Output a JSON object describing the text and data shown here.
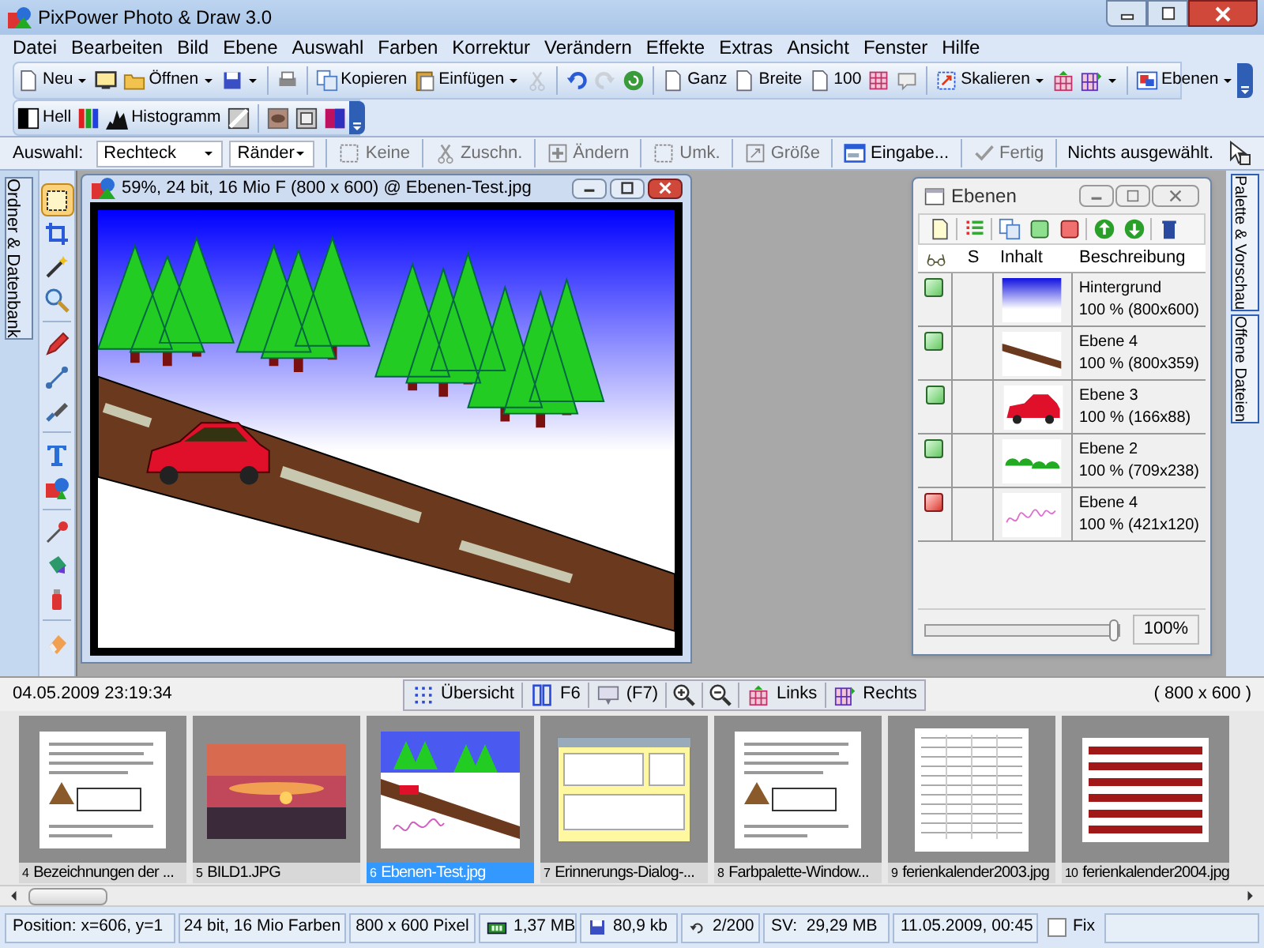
{
  "window": {
    "title": "PixPower Photo & Draw 3.0"
  },
  "menu": [
    "Datei",
    "Bearbeiten",
    "Bild",
    "Ebene",
    "Auswahl",
    "Farben",
    "Korrektur",
    "Verändern",
    "Effekte",
    "Extras",
    "Ansicht",
    "Fenster",
    "Hilfe"
  ],
  "toolbar_rows": [
    [
      {
        "kind": "button",
        "label": "Neu",
        "dropdown": true,
        "disabled": false
      },
      {
        "kind": "icon",
        "dropdown": false,
        "disabled": false
      },
      {
        "kind": "button",
        "label": "Öffnen",
        "dropdown": true,
        "disabled": false
      },
      {
        "kind": "icon",
        "dropdown": true,
        "disabled": false
      },
      {
        "kind": "separator"
      },
      {
        "kind": "icon",
        "dropdown": false,
        "disabled": false
      },
      {
        "kind": "separator"
      },
      {
        "kind": "button",
        "label": "Kopieren",
        "dropdown": false,
        "disabled": false
      },
      {
        "kind": "button",
        "label": "Einfügen",
        "dropdown": true,
        "disabled": false
      },
      {
        "kind": "icon",
        "dropdown": false,
        "disabled": true
      },
      {
        "kind": "separator"
      },
      {
        "kind": "icon",
        "dropdown": false,
        "disabled": false
      },
      {
        "kind": "icon",
        "dropdown": false,
        "disabled": true
      },
      {
        "kind": "icon",
        "dropdown": false,
        "disabled": false
      },
      {
        "kind": "separator"
      },
      {
        "kind": "button",
        "label": "Ganz",
        "dropdown": false,
        "disabled": false
      },
      {
        "kind": "button",
        "label": "Breite",
        "dropdown": false,
        "disabled": false
      },
      {
        "kind": "button",
        "label": "100",
        "dropdown": false,
        "disabled": false
      },
      {
        "kind": "icon",
        "dropdown": false,
        "disabled": false
      },
      {
        "kind": "icon",
        "dropdown": false,
        "disabled": false
      },
      {
        "kind": "separator"
      },
      {
        "kind": "button",
        "label": "Skalieren",
        "dropdown": true,
        "disabled": false
      },
      {
        "kind": "icon",
        "dropdown": false,
        "disabled": false
      },
      {
        "kind": "icon",
        "dropdown": true,
        "disabled": false
      },
      {
        "kind": "separator"
      },
      {
        "kind": "button",
        "label": "Ebenen",
        "dropdown": true,
        "disabled": false
      }
    ],
    [
      {
        "kind": "button",
        "label": "Hell",
        "dropdown": false,
        "disabled": false
      },
      {
        "kind": "icon",
        "dropdown": false,
        "disabled": false
      },
      {
        "kind": "button",
        "label": "Histogramm",
        "dropdown": false,
        "disabled": false
      },
      {
        "kind": "icon",
        "dropdown": false,
        "disabled": false
      },
      {
        "kind": "separator"
      },
      {
        "kind": "icon",
        "dropdown": false,
        "disabled": false
      },
      {
        "kind": "icon",
        "dropdown": false,
        "disabled": false
      },
      {
        "kind": "icon",
        "dropdown": false,
        "disabled": false
      }
    ]
  ],
  "options_bar": {
    "label": "Auswahl:",
    "selects": [
      {
        "value": "Rechteck"
      },
      {
        "value": "Ränder"
      }
    ],
    "buttons": [
      {
        "label": "Keine",
        "disabled": true
      },
      {
        "label": "Zuschn.",
        "disabled": true
      },
      {
        "label": "Ändern",
        "disabled": true
      },
      {
        "label": "Umk.",
        "disabled": true
      },
      {
        "label": "Größe",
        "disabled": true
      },
      {
        "label": "Eingabe...",
        "disabled": false
      },
      {
        "label": "Fertig",
        "disabled": true
      }
    ],
    "status": "Nichts ausgewählt."
  },
  "left_tabs": [
    {
      "label": "Ordner & Datenbank"
    }
  ],
  "tool_groups": [
    [
      {
        "selected": true
      },
      {
        "selected": false
      },
      {
        "selected": false
      },
      {
        "selected": false
      }
    ],
    [
      {
        "selected": false
      },
      {
        "selected": false
      },
      {
        "selected": false
      }
    ],
    [
      {
        "selected": false
      },
      {
        "selected": false
      }
    ],
    [
      {
        "selected": false
      },
      {
        "selected": false
      },
      {
        "selected": false
      }
    ],
    [
      {
        "selected": false
      }
    ]
  ],
  "image_window": {
    "title": "59%, 24 bit, 16 Mio F (800 x 600) @ Ebenen-Test.jpg"
  },
  "layers": {
    "title": "Ebenen",
    "columns": [
      "S",
      "Inhalt",
      "Beschreibung"
    ],
    "rows": [
      {
        "visible": true,
        "name": "Hintergrund",
        "info": "100 % (800x600)"
      },
      {
        "visible": true,
        "name": "Ebene 4",
        "info": "100 % (800x359)"
      },
      {
        "visible": true,
        "name": "Ebene 3",
        "info": "100 % (166x88)"
      },
      {
        "visible": true,
        "name": "Ebene 2",
        "info": "100 % (709x238)"
      },
      {
        "visible": false,
        "name": "Ebene 4",
        "info": "100 % (421x120)"
      }
    ],
    "opacity": {
      "level": 1,
      "reading": "100%"
    }
  },
  "right_tabs": [
    {
      "label": "Palette & Vorschau"
    },
    {
      "label": "Offene Dateien"
    }
  ],
  "strip_bar": {
    "date": "04.05.2009 23:19:34",
    "buttons": [
      {
        "kind": "labeled",
        "label": "Übersicht"
      },
      {
        "kind": "labeled",
        "label": "F6"
      },
      {
        "kind": "labeled",
        "label": "(F7)"
      },
      {
        "kind": "icon"
      },
      {
        "kind": "icon"
      },
      {
        "kind": "labeled",
        "label": "Links"
      },
      {
        "kind": "labeled",
        "label": "Rechts"
      }
    ],
    "dimensions": "( 800 x 600 )"
  },
  "thumbnails": [
    {
      "number": "4",
      "name": "Bezeichnungen der ...",
      "selected": false
    },
    {
      "number": "5",
      "name": "BILD1.JPG",
      "selected": false
    },
    {
      "number": "6",
      "name": "Ebenen-Test.jpg",
      "selected": true
    },
    {
      "number": "7",
      "name": "Erinnerungs-Dialog-...",
      "selected": false
    },
    {
      "number": "8",
      "name": "Farbpalette-Window...",
      "selected": false
    },
    {
      "number": "9",
      "name": "ferienkalender2003.jpg",
      "selected": false
    },
    {
      "number": "10",
      "name": "ferienkalender2004.jpg",
      "selected": false
    }
  ],
  "status_bar": {
    "position": "Position: x=606, y=1",
    "color_depth": "24 bit, 16 Mio Farben",
    "size": "800 x 600 Pixel",
    "memory": "1,37 MB",
    "file_size": "80,9 kb",
    "undo": "2/200",
    "swap": "SV:  29,29 MB",
    "date": "11.05.2009, 00:45",
    "fix": {
      "label": "Fix",
      "checked": false
    }
  }
}
